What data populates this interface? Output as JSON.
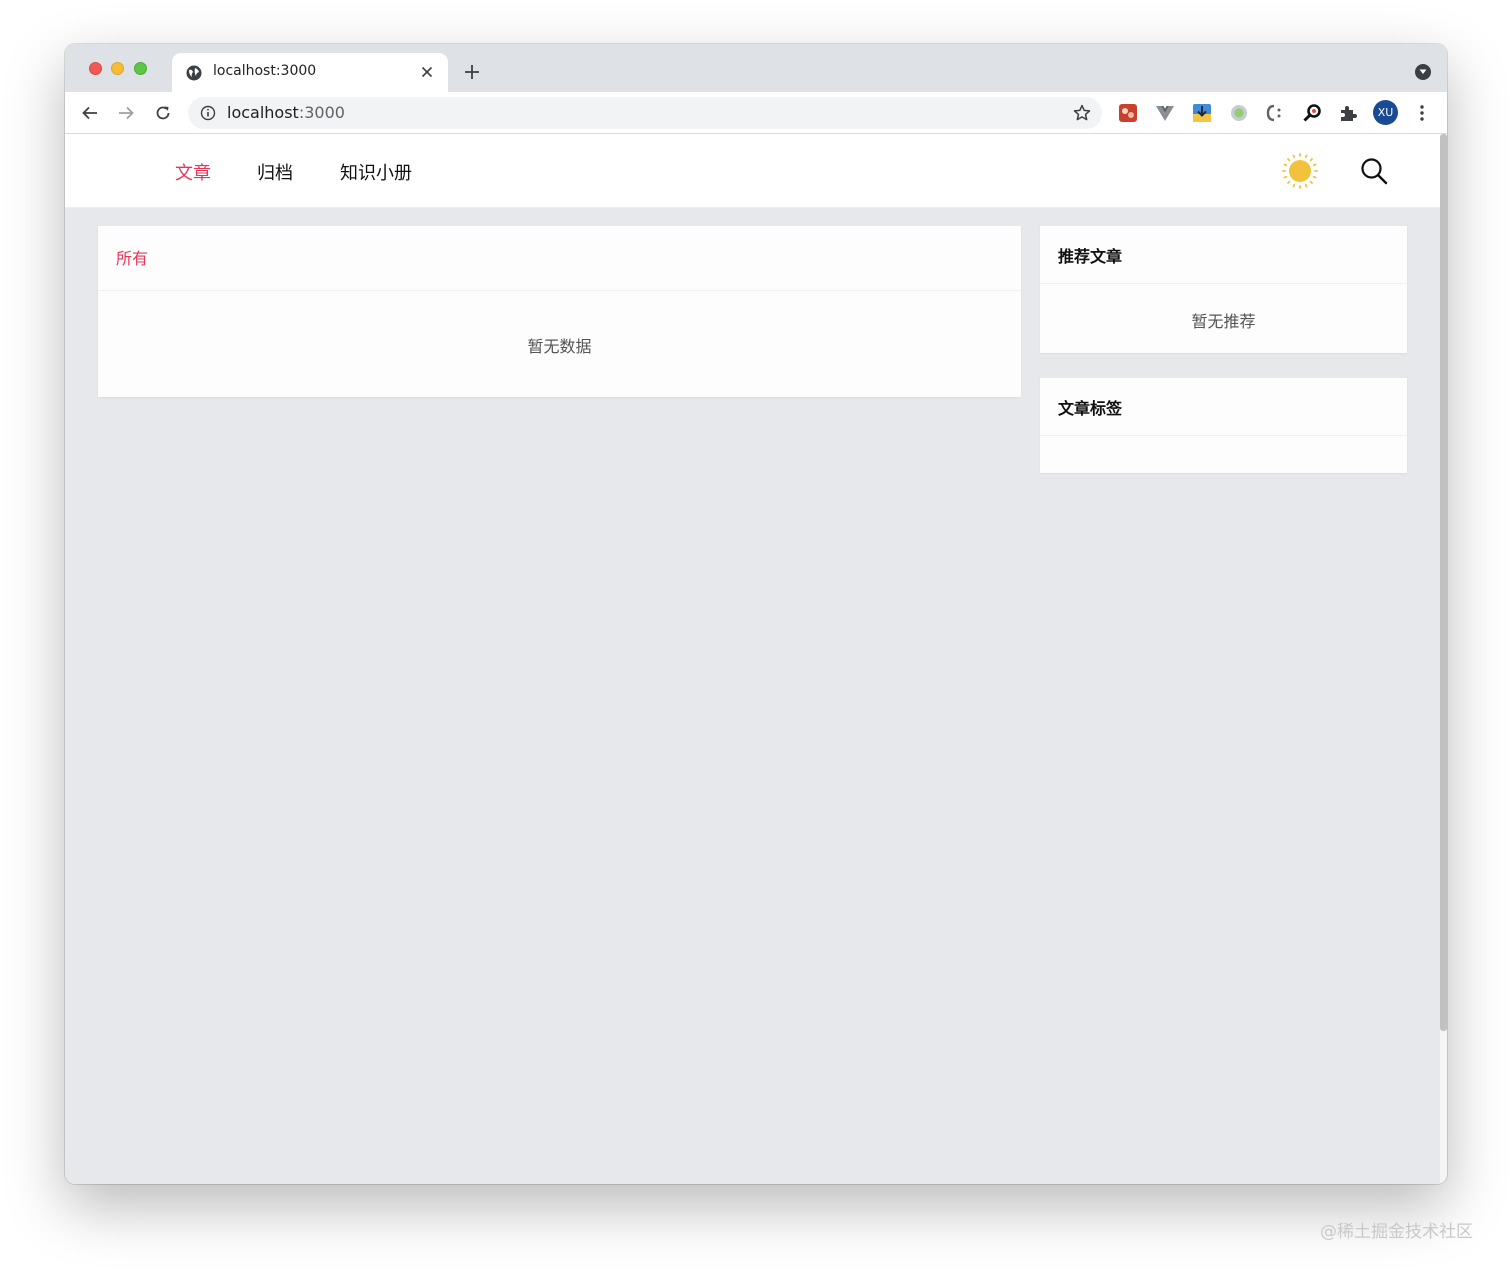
{
  "browser": {
    "tab_title": "localhost:3000",
    "url_host": "localhost",
    "url_port": ":3000",
    "profile_initials": "XU"
  },
  "nav": {
    "items": [
      {
        "label": "文章",
        "active": true
      },
      {
        "label": "归档",
        "active": false
      },
      {
        "label": "知识小册",
        "active": false
      }
    ]
  },
  "main": {
    "category_tab": "所有",
    "empty_text": "暂无数据"
  },
  "sidebar": {
    "recommend_title": "推荐文章",
    "recommend_empty": "暂无推荐",
    "tags_title": "文章标签"
  },
  "watermark": "@稀土掘金技术社区",
  "colors": {
    "accent": "#e6375a",
    "page_bg": "#e7e8eb",
    "sun": "#f3c23c"
  },
  "icons": [
    "globe-icon",
    "close-icon",
    "plus-icon",
    "back-icon",
    "forward-icon",
    "reload-icon",
    "info-icon",
    "star-icon",
    "puzzle-icon",
    "kebab-icon",
    "sun-icon",
    "search-icon"
  ]
}
